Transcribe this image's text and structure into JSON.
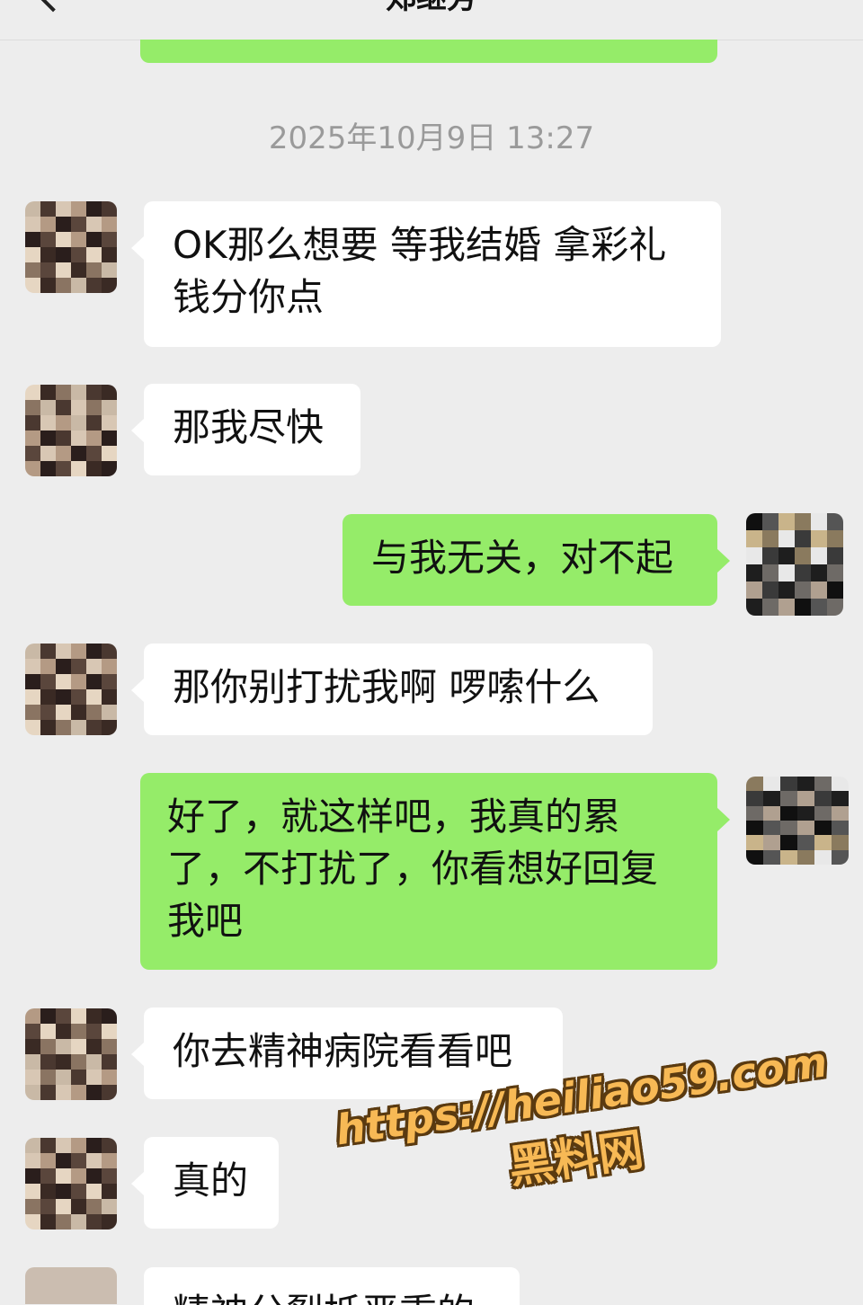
{
  "header": {
    "title": "郑继芳"
  },
  "timestamp": "2025年10月9日 13:27",
  "messages": [
    {
      "sender": "contact",
      "text": "OK那么想要 等我结婚 拿彩礼钱分你点"
    },
    {
      "sender": "contact",
      "text": "那我尽快"
    },
    {
      "sender": "me",
      "text": "与我无关，对不起"
    },
    {
      "sender": "contact",
      "text": "那你别打扰我啊 啰嗦什么"
    },
    {
      "sender": "me",
      "text": "好了，就这样吧，我真的累了，不打扰了，你看想好回复我吧"
    },
    {
      "sender": "contact",
      "text": "你去精神病院看看吧"
    },
    {
      "sender": "contact",
      "text": "真的"
    },
    {
      "sender": "contact",
      "text": "精神分裂抵恶重的"
    }
  ],
  "watermark": {
    "url": "https://heiliao59.com",
    "name": "黑料网"
  },
  "colors": {
    "background": "#ededed",
    "outgoing_bubble": "#95ec69",
    "incoming_bubble": "#ffffff",
    "timestamp_text": "#9a9a9a",
    "watermark_fill": "#f7b955"
  }
}
